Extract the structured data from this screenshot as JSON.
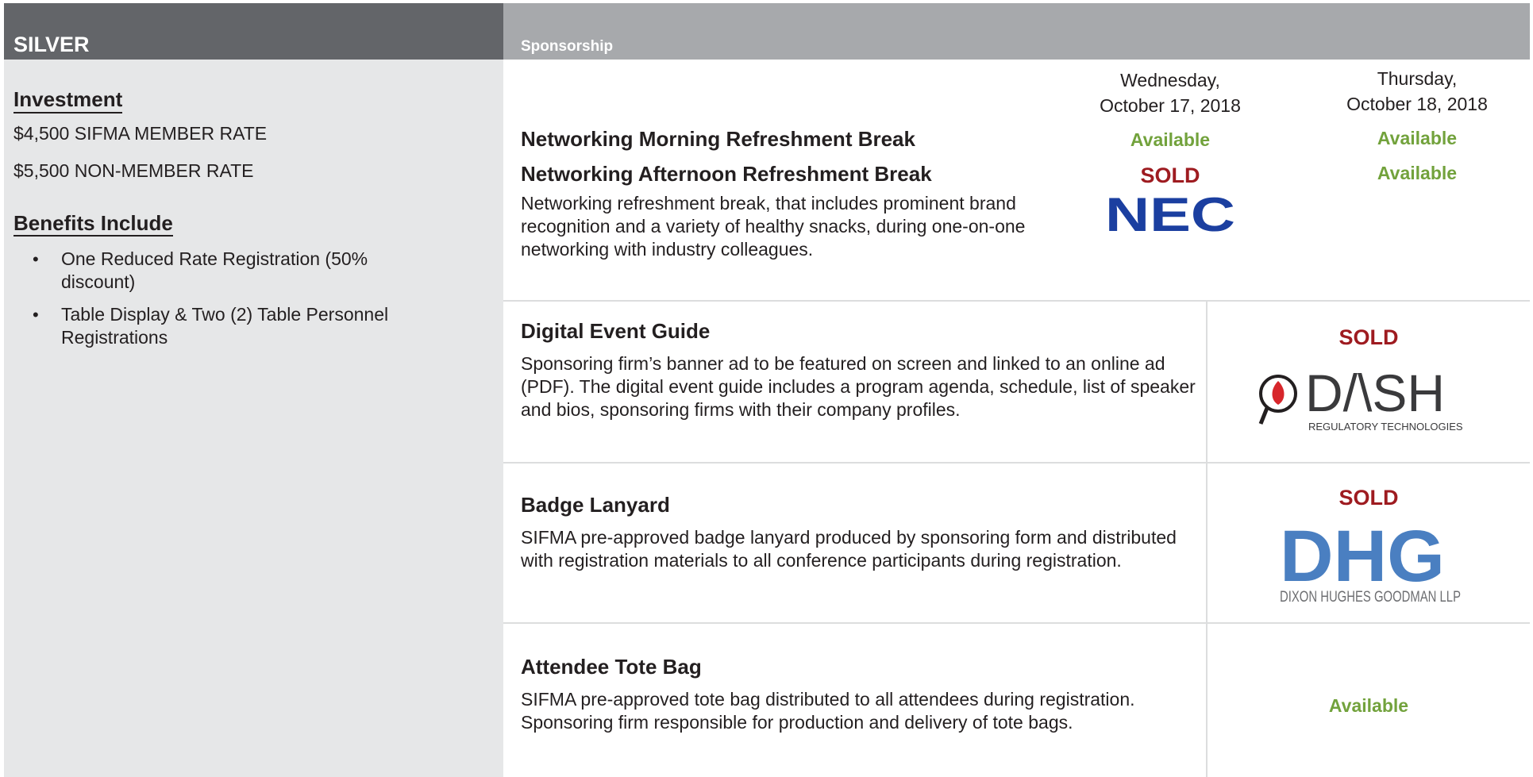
{
  "left": {
    "header": "SILVER",
    "investment_heading": "Investment",
    "member_rate": "$4,500 SIFMA MEMBER RATE",
    "non_member_rate": "$5,500 NON-MEMBER RATE",
    "benefits_heading": "Benefits Include",
    "benefits": [
      "One Reduced Rate Registration (50% discount)",
      "Table Display & Two (2) Table Personnel Registrations"
    ]
  },
  "right": {
    "header": "Sponsorship",
    "dates": [
      {
        "line1": "Wednesday,",
        "line2": "October 17, 2018"
      },
      {
        "line1": "Thursday,",
        "line2": "October 18, 2018"
      }
    ],
    "networking": {
      "morning_title": "Networking Morning Refreshment Break",
      "afternoon_title": "Networking Afternoon Refreshment Break",
      "description": "Networking refreshment break, that includes prominent brand recognition and a variety of healthy snacks, during one-on-one networking with industry colleagues.",
      "morning_wed": "Available",
      "morning_thu": "Available",
      "afternoon_wed": "SOLD",
      "afternoon_thu": "Available",
      "sponsor_logo_text": "NEC"
    },
    "items": [
      {
        "title": "Digital Event Guide",
        "description": "Sponsoring firm’s banner ad to be featured on screen and linked to an online ad (PDF). The digital event guide includes a program agenda, schedule, list of speaker and bios, sponsoring firms with their company profiles.",
        "status": "SOLD",
        "logo_text": "D/\\SH",
        "logo_sub": "REGULATORY TECHNOLOGIES"
      },
      {
        "title": "Badge Lanyard",
        "description": "SIFMA pre-approved badge lanyard produced by sponsoring form and distributed with registration materials to all conference participants during registration.",
        "status": "SOLD",
        "logo_text": "DHG",
        "logo_sub": "DIXON HUGHES GOODMAN LLP"
      },
      {
        "title": "Attendee Tote Bag",
        "description": "SIFMA pre-approved tote bag distributed to all attendees during registration. Sponsoring firm responsible for production and delivery of tote bags.",
        "status": "Available"
      }
    ]
  },
  "colors": {
    "left_header_bg": "#636569",
    "right_header_bg": "#a7a9ac",
    "left_panel_bg": "#e6e7e8",
    "available": "#72a23c",
    "sold": "#9e1b20",
    "nec_blue": "#1b3fa0",
    "dhg_blue": "#4a7fc1",
    "dash_red": "#d7262b"
  }
}
